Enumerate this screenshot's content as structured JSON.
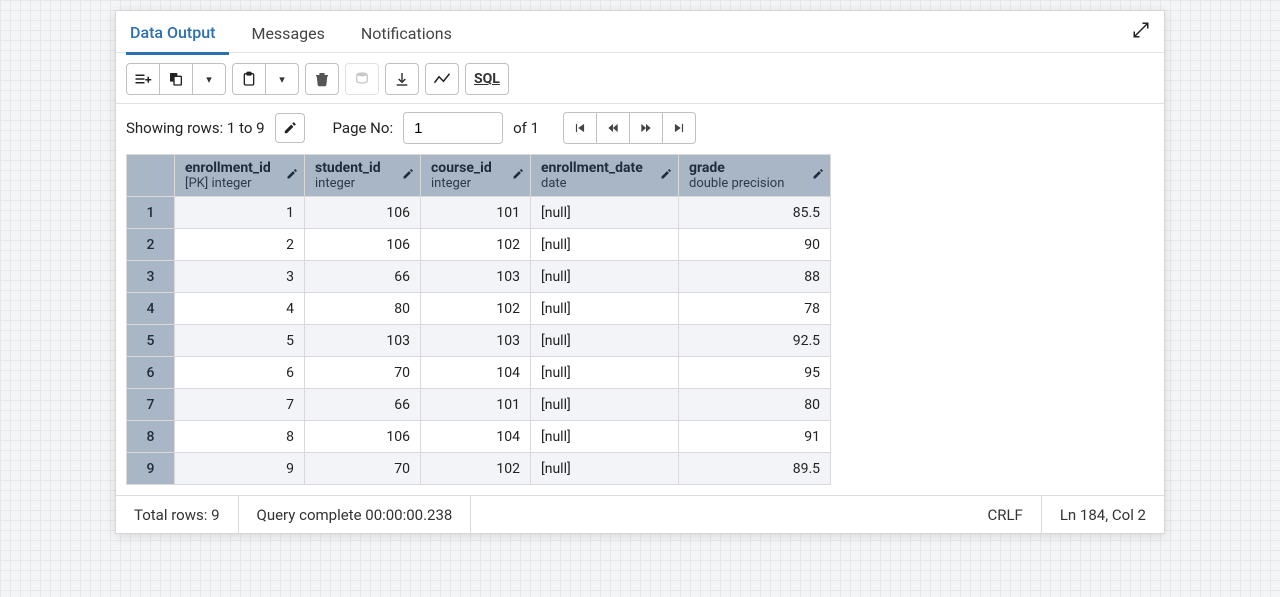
{
  "tabs": {
    "data_output": "Data Output",
    "messages": "Messages",
    "notifications": "Notifications"
  },
  "toolbar": {
    "sql_label": "SQL"
  },
  "pagebar": {
    "showing_label": "Showing rows: 1 to 9",
    "page_no_label": "Page No:",
    "page_value": "1",
    "of_label": "of 1"
  },
  "columns": [
    {
      "name": "enrollment_id",
      "type": "[PK] integer"
    },
    {
      "name": "student_id",
      "type": "integer"
    },
    {
      "name": "course_id",
      "type": "integer"
    },
    {
      "name": "enrollment_date",
      "type": "date"
    },
    {
      "name": "grade",
      "type": "double precision"
    }
  ],
  "rows": [
    {
      "n": "1",
      "enrollment_id": "1",
      "student_id": "106",
      "course_id": "101",
      "enrollment_date": "[null]",
      "grade": "85.5"
    },
    {
      "n": "2",
      "enrollment_id": "2",
      "student_id": "106",
      "course_id": "102",
      "enrollment_date": "[null]",
      "grade": "90"
    },
    {
      "n": "3",
      "enrollment_id": "3",
      "student_id": "66",
      "course_id": "103",
      "enrollment_date": "[null]",
      "grade": "88"
    },
    {
      "n": "4",
      "enrollment_id": "4",
      "student_id": "80",
      "course_id": "102",
      "enrollment_date": "[null]",
      "grade": "78"
    },
    {
      "n": "5",
      "enrollment_id": "5",
      "student_id": "103",
      "course_id": "103",
      "enrollment_date": "[null]",
      "grade": "92.5"
    },
    {
      "n": "6",
      "enrollment_id": "6",
      "student_id": "70",
      "course_id": "104",
      "enrollment_date": "[null]",
      "grade": "95"
    },
    {
      "n": "7",
      "enrollment_id": "7",
      "student_id": "66",
      "course_id": "101",
      "enrollment_date": "[null]",
      "grade": "80"
    },
    {
      "n": "8",
      "enrollment_id": "8",
      "student_id": "106",
      "course_id": "104",
      "enrollment_date": "[null]",
      "grade": "91"
    },
    {
      "n": "9",
      "enrollment_id": "9",
      "student_id": "70",
      "course_id": "102",
      "enrollment_date": "[null]",
      "grade": "89.5"
    }
  ],
  "footer": {
    "total_rows": "Total rows: 9",
    "query_time": "Query complete 00:00:00.238",
    "line_ending": "CRLF",
    "cursor": "Ln 184, Col 2"
  }
}
